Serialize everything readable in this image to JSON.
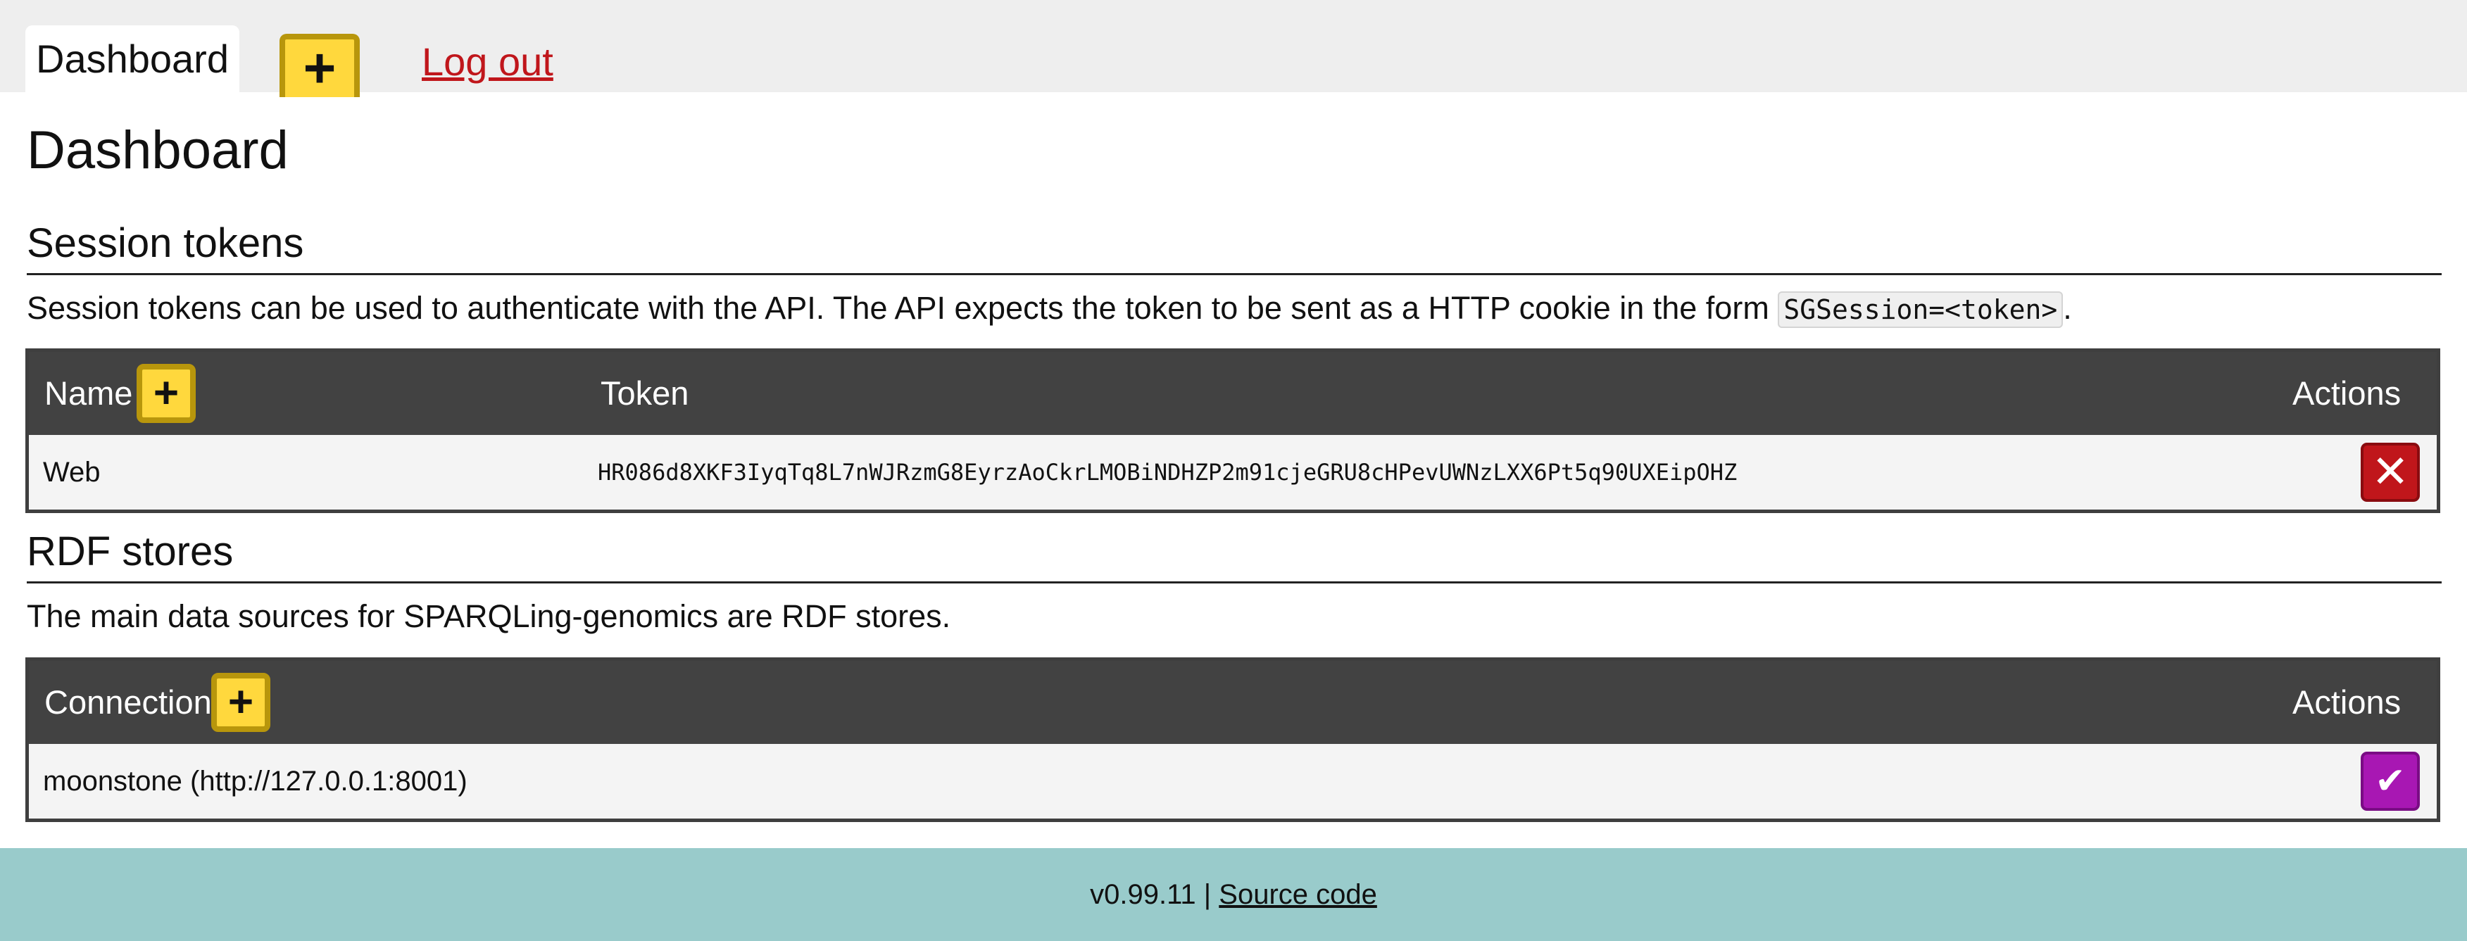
{
  "nav": {
    "active_tab": "Dashboard",
    "add_icon": "plus-icon",
    "add_symbol": "+",
    "logout": "Log out"
  },
  "page_title": "Dashboard",
  "session_tokens": {
    "heading": "Session tokens",
    "description": "Session tokens can be used to authenticate with the API. The API expects the token to be sent as a HTTP cookie in the form",
    "cookie_format": "SGSession=<token>",
    "description_end": ".",
    "columns": {
      "name": "Name",
      "token": "Token",
      "actions": "Actions"
    },
    "rows": [
      {
        "name": "Web",
        "token": "HR086d8XKF3IyqTq8L7nWJRzmG8EyrzAoCkrLMOBiNDHZP2m91cjeGRU8cHPevUWNzLXX6Pt5q90UXEipOHZ",
        "action_icon": "close-icon",
        "action_symbol": "✕"
      }
    ]
  },
  "rdf_stores": {
    "heading": "RDF stores",
    "description": "The main data sources for SPARQLing-genomics are RDF stores.",
    "columns": {
      "connection": "Connection",
      "actions": "Actions"
    },
    "rows": [
      {
        "connection": "moonstone (http://127.0.0.1:8001)",
        "action_icon": "check-icon",
        "action_symbol": "✔"
      }
    ]
  },
  "footer": {
    "version": "v0.99.11 |",
    "source_link": "Source code"
  },
  "colors": {
    "accent_yellow": "#ffd83d",
    "delete_red": "#c0161b",
    "select_purple": "#a817b3",
    "footer_teal": "#99cbcb",
    "table_header": "#424242"
  }
}
